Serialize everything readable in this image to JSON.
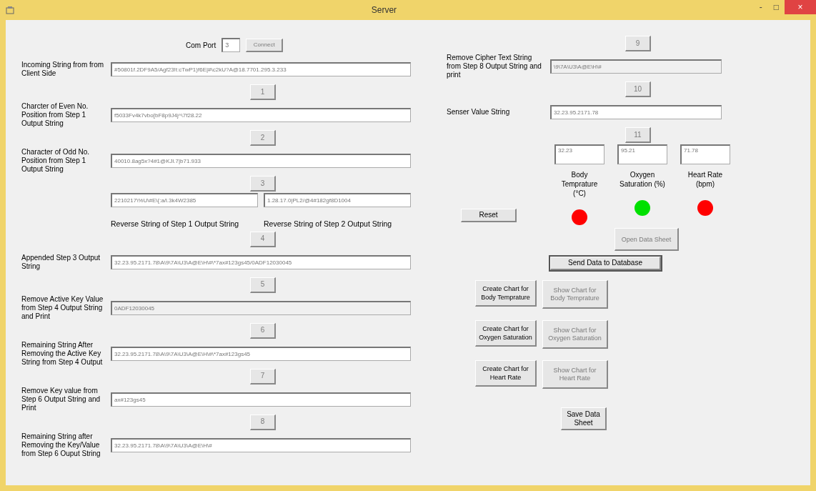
{
  "window": {
    "title": "Server",
    "controls": [
      "-",
      "□",
      "×"
    ]
  },
  "com_port": {
    "label": "Com Port",
    "value": "3",
    "connect_button": {
      "label": "Connect",
      "disabled": true
    }
  },
  "left_steps": [
    {
      "kind": "field",
      "label": "Incoming String from from Client Side",
      "value": "#50801f.2DF9A5/Agf23!t:cTwP1)f6E|#\\c2kU?A@18.7701.295.3.233",
      "readonly": false
    },
    {
      "kind": "button",
      "label": "1",
      "disabled": true
    },
    {
      "kind": "field",
      "label": "Charcter of Even No. Position from Step 1 Output String",
      "value": "f5033Fv4k7vbo[bF8p9J4j^\\7f28.22",
      "readonly": false
    },
    {
      "kind": "button",
      "label": "2",
      "disabled": true
    },
    {
      "kind": "field",
      "label": "Character of Odd No. Position from Step 1 Output String",
      "value": "40010.8ag5x?4#1@KJl.7|b71.933",
      "readonly": false
    },
    {
      "kind": "button",
      "label": "3",
      "disabled": true
    },
    {
      "kind": "pair",
      "fields": [
        {
          "value": "2210217\\%U\\#E\\{:a/l.3k4W2385",
          "caption": "Reverse String of Step 1 Output String"
        },
        {
          "value": "1.28.17.0|PL2/@4#182gf8D1004",
          "caption": "Reverse String of Step 2 Output String"
        }
      ]
    },
    {
      "kind": "button",
      "label": "4",
      "disabled": true
    },
    {
      "kind": "field",
      "label": "Appended Step 3 Output String",
      "value": "32.23.95.2171.78\\A\\9\\7A\\U3\\A@E\\H\\#\\*7ax#123gs45/0ADF12030045",
      "readonly": false
    },
    {
      "kind": "button",
      "label": "5",
      "disabled": true
    },
    {
      "kind": "field",
      "label": "Remove Active Key Value from Step 4 Output String and Print",
      "value": "0ADF12030045",
      "readonly": true
    },
    {
      "kind": "button",
      "label": "6",
      "disabled": true
    },
    {
      "kind": "field",
      "label": "Remaining String After Removing the Active Key String from Step 4 Output",
      "value": "32.23.95.2171.78\\A\\9\\7A\\U3\\A@E\\H\\#\\*7ax#123gs45",
      "readonly": false
    },
    {
      "kind": "button",
      "label": "7",
      "disabled": true
    },
    {
      "kind": "field",
      "label": "Remove Key value from Step 6 Output String and Print",
      "value": "ax#123gs45",
      "readonly": false
    },
    {
      "kind": "button",
      "label": "8",
      "disabled": true
    },
    {
      "kind": "field",
      "label": "Remaining String after Removing the Key/Value from Step 6 Ouput String",
      "value": "32.23.95.2171.78\\A\\9\\7A\\U3\\A@E\\H\\#",
      "readonly": false
    }
  ],
  "right_steps": [
    {
      "kind": "button",
      "label": "9",
      "disabled": true
    },
    {
      "kind": "field",
      "label": "Remove Cipher Text String from Step 8 Output String and print",
      "value": "\\9\\7A\\U3\\A@E\\H\\#",
      "readonly": true
    },
    {
      "kind": "button",
      "label": "10",
      "disabled": true
    },
    {
      "kind": "field",
      "label": "Senser Value String",
      "value": "32.23.95.2171.78",
      "readonly": false
    },
    {
      "kind": "button",
      "label": "11",
      "disabled": true
    }
  ],
  "indicators": [
    {
      "value": "32.23",
      "caption": "Body Temprature (°C)",
      "color": "#ff0000"
    },
    {
      "value": "95.21",
      "caption": "Oxygen Saturation (%)",
      "color": "#00e000"
    },
    {
      "value": "71.78",
      "caption": "Heart Rate (bpm)",
      "color": "#ff0000"
    }
  ],
  "reset_button": {
    "label": "Reset",
    "disabled": false
  },
  "open_sheet_button": {
    "label": "Open Data Sheet",
    "disabled": true
  },
  "send_button": {
    "label": "Send Data to Database",
    "disabled": false,
    "focused": true
  },
  "chart_buttons": [
    {
      "create": {
        "label": "Create Chart for Body Temprature",
        "disabled": false
      },
      "show": {
        "label": "Show Chart for Body Temprature",
        "disabled": true
      }
    },
    {
      "create": {
        "label": "Create Chart for Oxygen Saturation",
        "disabled": false
      },
      "show": {
        "label": "Show Chart for Oxygen Saturation",
        "disabled": true
      }
    },
    {
      "create": {
        "label": "Create Chart for Heart Rate",
        "disabled": false
      },
      "show": {
        "label": "Show Chart for Heart Rate",
        "disabled": true
      }
    }
  ],
  "save_button": {
    "label": "Save Data Sheet",
    "disabled": false
  }
}
